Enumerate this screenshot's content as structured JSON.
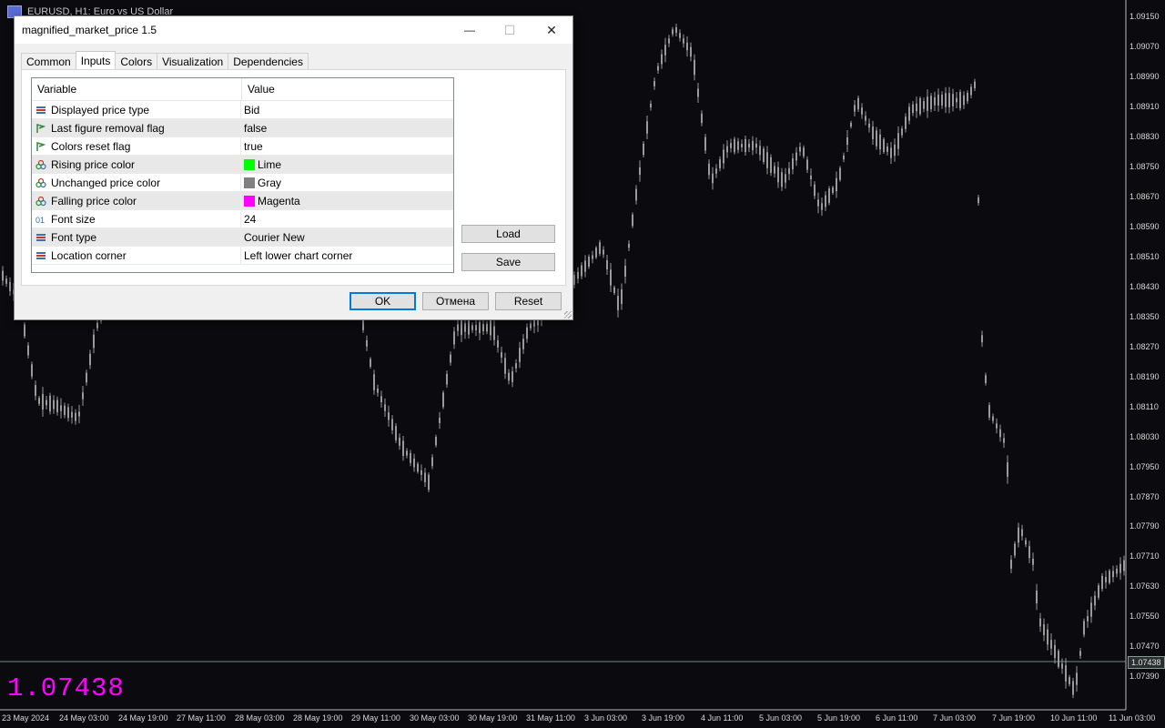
{
  "chart": {
    "window_title": "EURUSD, H1:  Euro vs US Dollar",
    "current_price": "1.07438",
    "big_price_text": "1.07438",
    "colors": {
      "background": "#0b0b0f",
      "candles": "#9a9a9a",
      "price_line": "#6e8c8c",
      "big_price": "#ff00ff"
    },
    "price_axis": [
      "1.09150",
      "1.09070",
      "1.08990",
      "1.08910",
      "1.08830",
      "1.08750",
      "1.08670",
      "1.08590",
      "1.08510",
      "1.08430",
      "1.08350",
      "1.08270",
      "1.08190",
      "1.08110",
      "1.08030",
      "1.07950",
      "1.07870",
      "1.07790",
      "1.07710",
      "1.07630",
      "1.07550",
      "1.07470",
      "1.07390"
    ],
    "time_axis": [
      "23 May 2024",
      "24 May 03:00",
      "24 May 19:00",
      "27 May 11:00",
      "28 May 03:00",
      "28 May 19:00",
      "29 May 11:00",
      "30 May 03:00",
      "30 May 19:00",
      "31 May 11:00",
      "3 Jun 03:00",
      "3 Jun 19:00",
      "4 Jun 11:00",
      "5 Jun 03:00",
      "5 Jun 19:00",
      "6 Jun 11:00",
      "7 Jun 03:00",
      "7 Jun 19:00",
      "10 Jun 11:00",
      "11 Jun 03:00"
    ]
  },
  "dialog": {
    "title": "magnified_market_price 1.5",
    "controls": {
      "minimize": "—",
      "maximize": "☐",
      "close": "✕"
    },
    "tabs": [
      "Common",
      "Inputs",
      "Colors",
      "Visualization",
      "Dependencies"
    ],
    "active_tab": "Inputs",
    "grid": {
      "headers": {
        "variable": "Variable",
        "value": "Value"
      },
      "rows": [
        {
          "icon": "enum-icon",
          "variable": "Displayed price type",
          "value": "Bid"
        },
        {
          "icon": "bool-icon",
          "variable": "Last figure removal flag",
          "value": "false"
        },
        {
          "icon": "bool-icon",
          "variable": "Colors reset flag",
          "value": "true"
        },
        {
          "icon": "color-icon",
          "variable": "Rising price color",
          "value": "Lime",
          "swatch": "#00ff00"
        },
        {
          "icon": "color-icon",
          "variable": "Unchanged price color",
          "value": "Gray",
          "swatch": "#808080"
        },
        {
          "icon": "color-icon",
          "variable": "Falling price color",
          "value": "Magenta",
          "swatch": "#ff00ff"
        },
        {
          "icon": "int-icon",
          "variable": "Font size",
          "value": "24"
        },
        {
          "icon": "enum-icon",
          "variable": "Font type",
          "value": "Courier New"
        },
        {
          "icon": "enum-icon",
          "variable": "Location corner",
          "value": "Left lower chart corner"
        }
      ]
    },
    "side_buttons": {
      "load": "Load",
      "save": "Save"
    },
    "footer_buttons": {
      "ok": "OK",
      "cancel": "Отмена",
      "reset": "Reset"
    }
  }
}
